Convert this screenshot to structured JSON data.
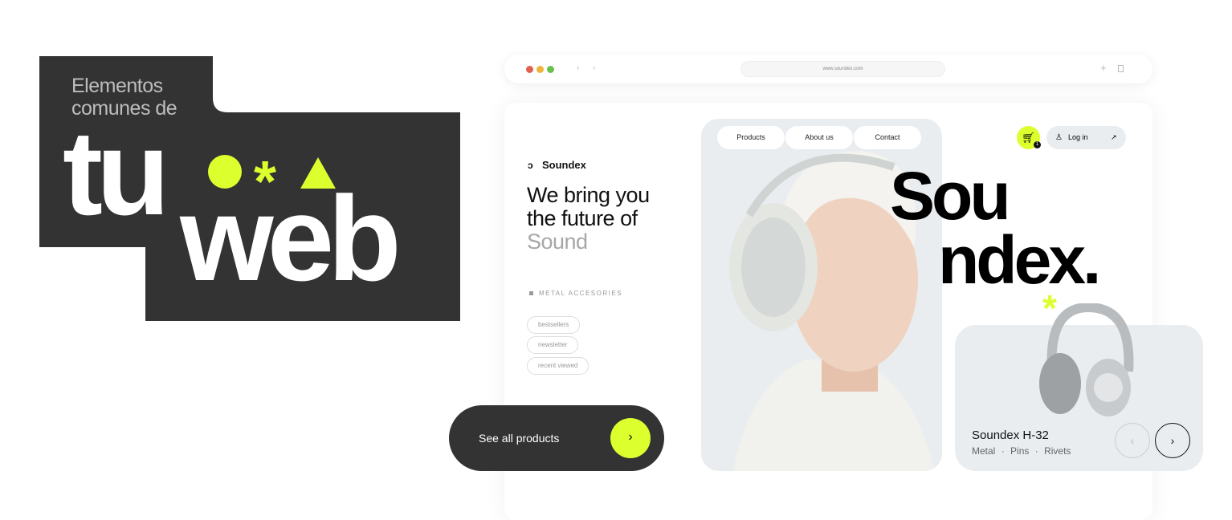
{
  "promo": {
    "intro_line1": "Elementos",
    "intro_line2": "comunes de",
    "word1": "tu",
    "word2": "web"
  },
  "colors": {
    "accent": "#dcff2e",
    "dark": "#333333",
    "panel": "#e9edf0"
  },
  "browser": {
    "url": "www.soundex.com",
    "icons": [
      "close-dot",
      "minimize-dot",
      "maximize-dot",
      "back-icon",
      "forward-icon",
      "plus-icon",
      "copy-icon"
    ]
  },
  "site": {
    "brand": "Soundex",
    "nav": [
      "Products",
      "About us",
      "Contact"
    ],
    "cart_count": "1",
    "login": "Log in",
    "headline_1": "We bring you",
    "headline_2": "the future of",
    "headline_3": "Sound",
    "category": "METAL ACCESORIES",
    "tags": [
      "bestsellers",
      "newsletter",
      "recent viewed"
    ],
    "big_1": "Sou",
    "big_2": "ndex.",
    "cta": "See all products",
    "product": {
      "name": "Soundex H-32",
      "features": [
        "Metal",
        "Pins",
        "Rivets"
      ],
      "sep": "·"
    }
  }
}
